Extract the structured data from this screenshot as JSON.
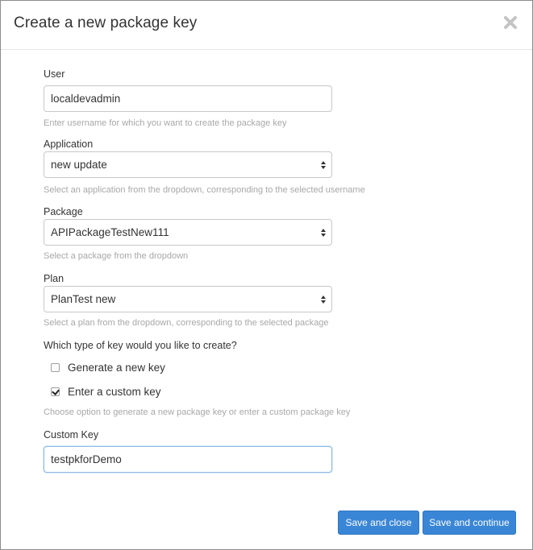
{
  "modal": {
    "title": "Create a new package key"
  },
  "user": {
    "label": "User",
    "value": "localdevadmin",
    "help": "Enter username for which you want to create the package key"
  },
  "application": {
    "label": "Application",
    "selected": "new update",
    "help": "Select an application from the dropdown, corresponding to the selected username"
  },
  "package": {
    "label": "Package",
    "selected": "APIPackageTestNew111",
    "help": "Select a package from the dropdown"
  },
  "plan": {
    "label": "Plan",
    "selected": "PlanTest new",
    "help": "Select a plan from the dropdown, corresponding to the selected package"
  },
  "key_type": {
    "question": "Which type of key would you like to create?",
    "options": [
      {
        "label": "Generate a new key",
        "checked": false
      },
      {
        "label": "Enter a custom key",
        "checked": true
      }
    ],
    "help": "Choose option to generate a new package key or enter a custom package key"
  },
  "custom_key": {
    "label": "Custom Key",
    "value": "testpkforDemo"
  },
  "footer": {
    "save_close_label": "Save and close",
    "save_continue_label": "Save and continue"
  },
  "colors": {
    "primary_button": "#3a86d6",
    "help_text": "#a8a8a8"
  }
}
